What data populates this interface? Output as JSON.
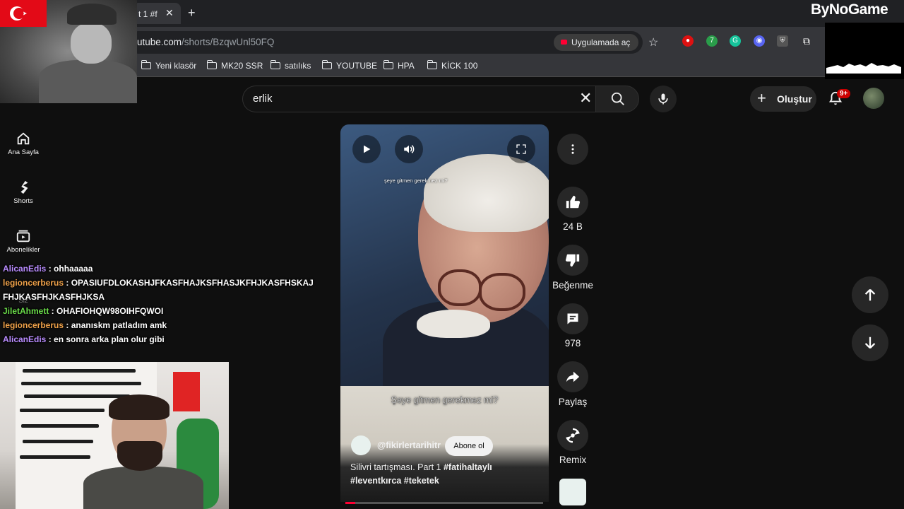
{
  "browser": {
    "tab_title": "t 1 #f",
    "url_host": "utube.com",
    "url_path": "/shorts/BzqwUnl50FQ",
    "open_in_app": "Uygulamada aç",
    "extension_badge": "7",
    "bookmarks": [
      "Yeni klasör",
      "MK20 SSR",
      "satılıks",
      "YOUTUBE",
      "HPA",
      "KİCK 100"
    ]
  },
  "youtube": {
    "search_value": "erlik",
    "create_label": "Oluştur",
    "notification_badge": "9+",
    "sidebar": [
      {
        "label": "Ana Sayfa",
        "icon": "home-icon"
      },
      {
        "label": "Shorts",
        "icon": "shorts-icon"
      },
      {
        "label": "Abonelikler",
        "icon": "subscriptions-icon"
      },
      {
        "label": "Siz",
        "icon": "you-icon"
      }
    ],
    "short": {
      "top_caption": "şeye gitmen gerekmez mi?",
      "subtitle": "Şeye gitmen gerekmez mi?",
      "channel": "@fikirlertarihitr",
      "subscribe": "Abone ol",
      "caption_plain": "Silivri tartışması. Part 1 ",
      "caption_tag1": "#fatihaltaylı",
      "caption_tag2": "#leventkırca",
      "caption_tag3": "#teketek",
      "progress": 0.05
    },
    "actions": {
      "likes": "24 B",
      "dislike": "Beğenme",
      "comments": "978",
      "share": "Paylaş",
      "remix": "Remix"
    }
  },
  "overlay": {
    "logo": "ByNoGame",
    "chat": [
      {
        "user": "AlicanEdis",
        "color": "#b98cff",
        "msg": "ohhaaaaa"
      },
      {
        "user": "legioncerberus",
        "color": "#f0a24a",
        "msg": "OPASIUFDLOKASHJFKASFHAJKSFHASJKFHJKASFHSKAJFHJKASFHJKASFHJKSA"
      },
      {
        "user": "JiletAhmett",
        "color": "#6bdc4a",
        "msg": "OHAFIOHQW98OIHFQWOI"
      },
      {
        "user": "legioncerberus",
        "color": "#f0a24a",
        "msg": "ananıskm patladım amk"
      },
      {
        "user": "AlicanEdis",
        "color": "#b98cff",
        "msg": "en sonra arka plan olur gibi"
      }
    ]
  },
  "colors": {
    "accent": "#ff0033",
    "bg": "#0f0f0f"
  }
}
